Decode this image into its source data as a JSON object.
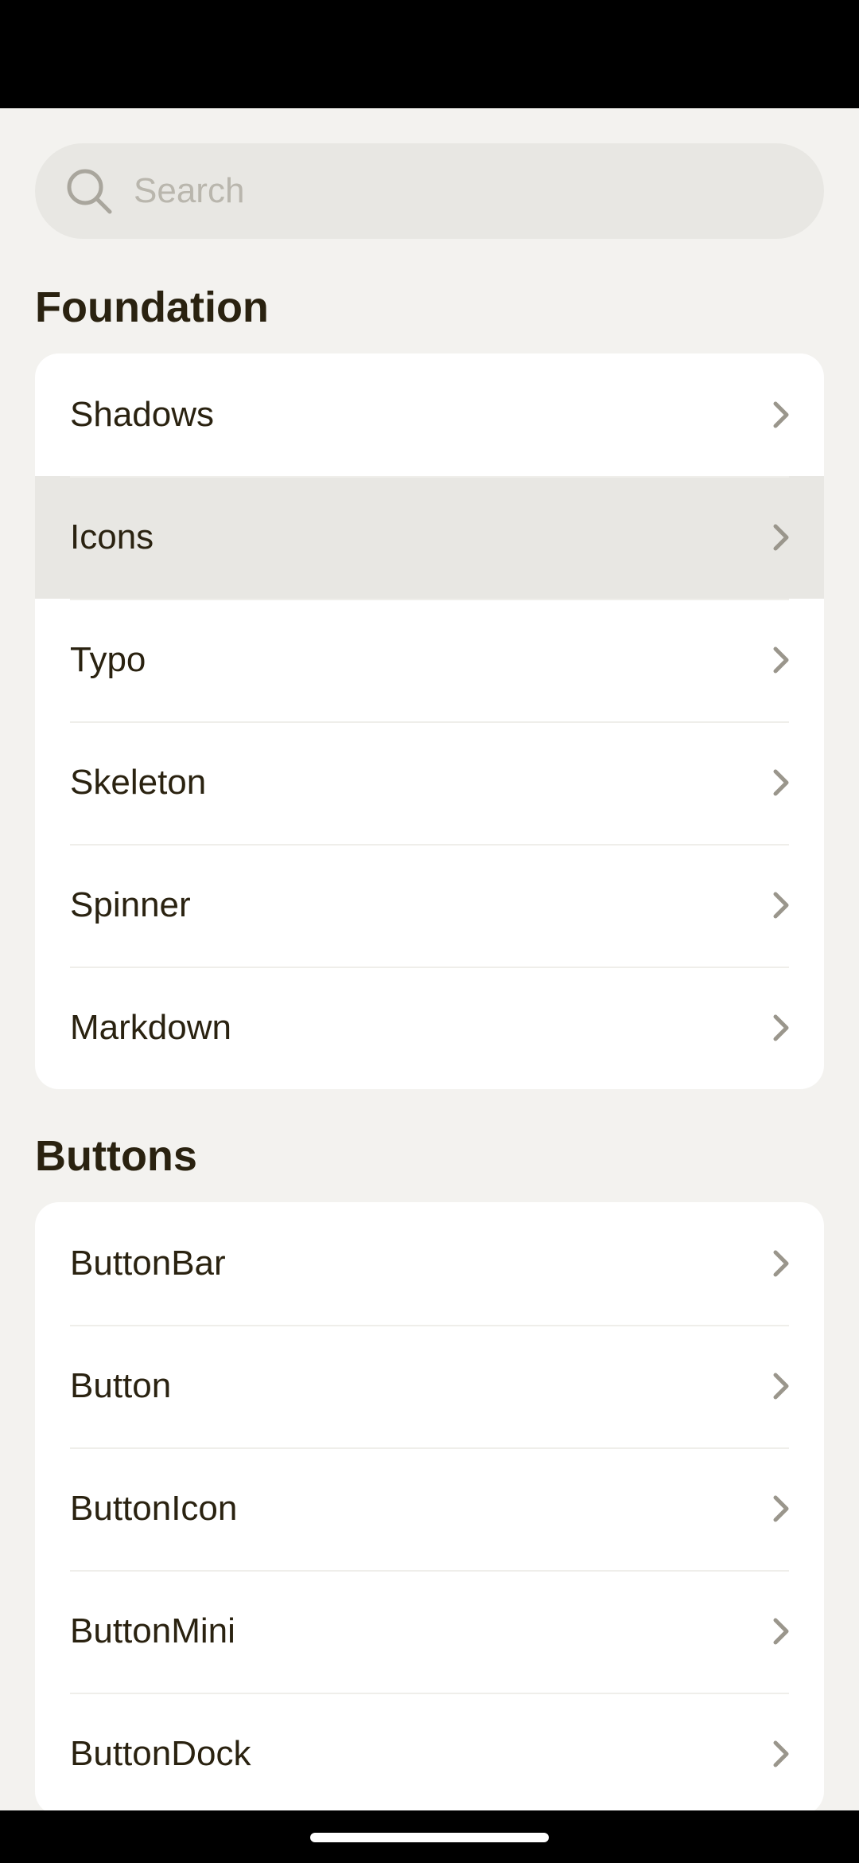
{
  "search": {
    "placeholder": "Search",
    "icon": "search-icon"
  },
  "sections": [
    {
      "title": "Foundation",
      "items": [
        {
          "label": "Shadows"
        },
        {
          "label": "Icons",
          "highlighted": true
        },
        {
          "label": "Typo"
        },
        {
          "label": "Skeleton"
        },
        {
          "label": "Spinner"
        },
        {
          "label": "Markdown"
        }
      ]
    },
    {
      "title": "Buttons",
      "items": [
        {
          "label": "ButtonBar"
        },
        {
          "label": "Button"
        },
        {
          "label": "ButtonIcon"
        },
        {
          "label": "ButtonMini"
        },
        {
          "label": "ButtonDock"
        }
      ]
    }
  ],
  "colors": {
    "background": "#f3f2ef",
    "card": "#ffffff",
    "highlight": "#e8e7e3",
    "text": "#2a2210",
    "muted": "#b9b6ad",
    "chevron": "#9a968c"
  }
}
